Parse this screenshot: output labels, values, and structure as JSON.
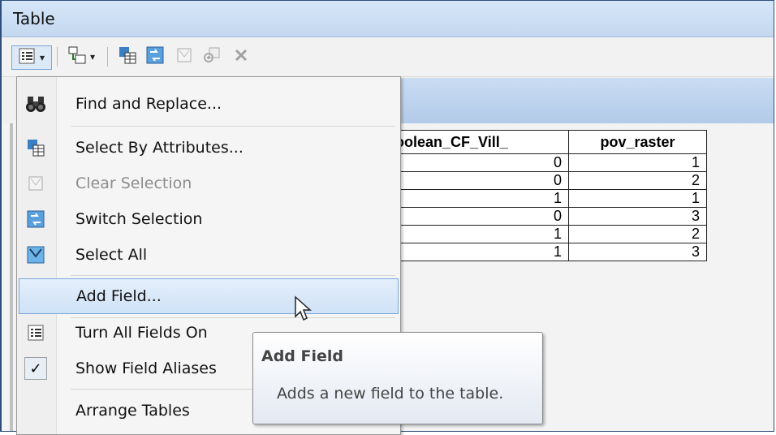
{
  "window": {
    "title": "Table"
  },
  "toolbar": {
    "icons": [
      "table-options-icon",
      "related-tables-icon",
      "select-by-attributes-icon",
      "switch-selection-icon",
      "clear-selection-icon",
      "zoom-to-selected-icon",
      "delete-selected-icon"
    ]
  },
  "grid": {
    "columns": [
      "oolean_CF_Vill_",
      "pov_raster"
    ],
    "rows": [
      [
        "0",
        "1"
      ],
      [
        "0",
        "2"
      ],
      [
        "1",
        "1"
      ],
      [
        "0",
        "3"
      ],
      [
        "1",
        "2"
      ],
      [
        "1",
        "3"
      ]
    ]
  },
  "menu": {
    "items": [
      {
        "label": "Find and Replace...",
        "icon": "binoculars-icon",
        "enabled": true
      },
      {
        "label": "Select By Attributes...",
        "icon": "select-by-attributes-icon",
        "enabled": true
      },
      {
        "label": "Clear Selection",
        "icon": "clear-selection-icon",
        "enabled": false
      },
      {
        "label": "Switch Selection",
        "icon": "switch-selection-icon",
        "enabled": true
      },
      {
        "label": "Select All",
        "icon": "select-all-icon",
        "enabled": true
      },
      {
        "label": "Add Field...",
        "icon": "",
        "enabled": true,
        "highlighted": true
      },
      {
        "label": "Turn All Fields On",
        "icon": "fields-list-icon",
        "enabled": true
      },
      {
        "label": "Show Field Aliases",
        "icon": "checkmark-icon",
        "enabled": true,
        "checked": true
      },
      {
        "label": "Arrange Tables",
        "icon": "",
        "enabled": true
      }
    ]
  },
  "tooltip": {
    "title": "Add Field",
    "body": "Adds a new field to the table."
  },
  "colors": {
    "titlebar": "#c9dcf2",
    "highlight": "#cfe2f7",
    "highlight_border": "#7aa7d8"
  }
}
